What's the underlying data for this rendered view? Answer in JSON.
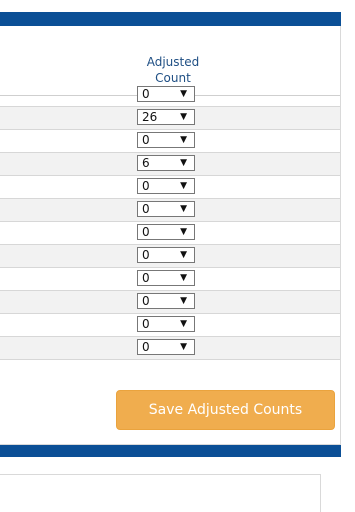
{
  "table": {
    "header": "Adjusted\nCount",
    "rows": [
      {
        "value": "0"
      },
      {
        "value": "26"
      },
      {
        "value": "0"
      },
      {
        "value": "6"
      },
      {
        "value": "0"
      },
      {
        "value": "0"
      },
      {
        "value": "0"
      },
      {
        "value": "0"
      },
      {
        "value": "0"
      },
      {
        "value": "0"
      },
      {
        "value": "0"
      },
      {
        "value": "0"
      }
    ]
  },
  "actions": {
    "save_label": "Save Adjusted Counts"
  },
  "colors": {
    "bar": "#0b4f96",
    "header_text": "#1f4f84",
    "button": "#f0ad4e"
  }
}
